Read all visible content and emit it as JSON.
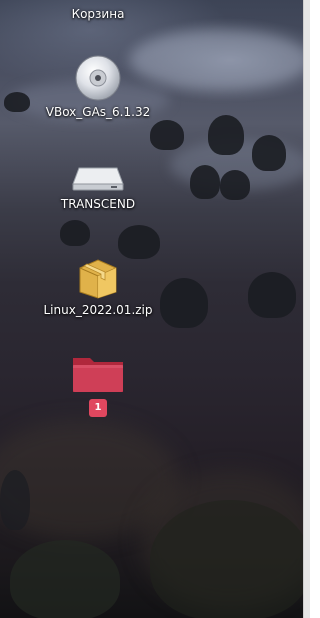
{
  "desktop": {
    "icons": [
      {
        "label": "Корзина",
        "icon": "trash-icon"
      },
      {
        "label": "VBox_GAs_6.1.32",
        "icon": "optical-disc-icon"
      },
      {
        "label": "TRANSCEND",
        "icon": "drive-icon"
      },
      {
        "label": "Linux_2022.01.zip",
        "icon": "archive-box-icon"
      },
      {
        "label": "",
        "icon": "folder-icon",
        "badge": "1"
      }
    ]
  }
}
